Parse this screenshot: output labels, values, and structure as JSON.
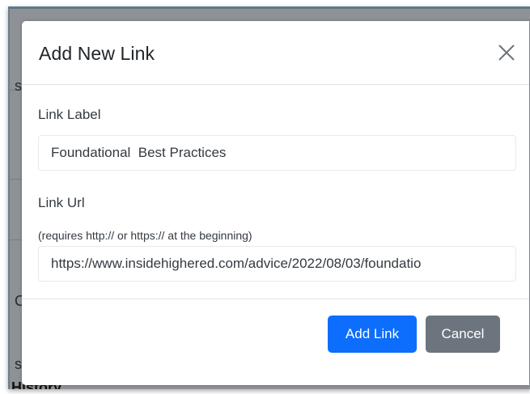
{
  "modal": {
    "title": "Add New Link",
    "close_icon": "close-icon"
  },
  "form": {
    "label_field": {
      "label": "Link Label",
      "value": "Foundational  Best Practices"
    },
    "url_field": {
      "label": "Link Url",
      "hint": "(requires http:// or https:// at the beginning)",
      "value": "https://www.insidehighered.com/advice/2022/08/03/foundatio"
    }
  },
  "footer": {
    "add_label": "Add Link",
    "cancel_label": "Cancel"
  },
  "background": {
    "fragments": [
      "s",
      "C",
      "s"
    ],
    "history_label": "History"
  },
  "colors": {
    "primary": "#0d6efd",
    "secondary": "#6c757d",
    "backdrop": "#8e9296"
  }
}
